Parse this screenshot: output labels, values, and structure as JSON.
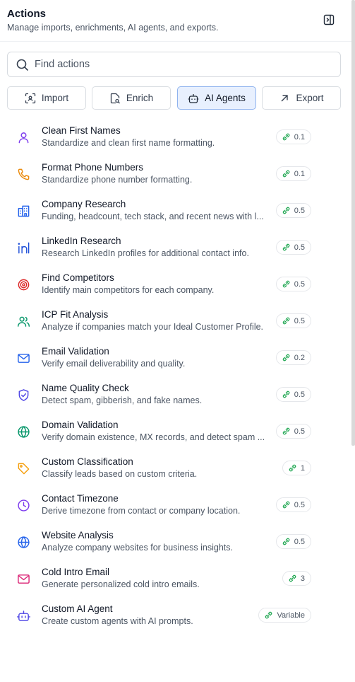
{
  "header": {
    "title": "Actions",
    "subtitle": "Manage imports, enrichments, AI agents, and exports."
  },
  "search": {
    "placeholder": "Find actions",
    "value": ""
  },
  "tabs": [
    {
      "label": "Import",
      "icon": "scan-icon",
      "active": false
    },
    {
      "label": "Enrich",
      "icon": "file-search-icon",
      "active": false
    },
    {
      "label": "AI Agents",
      "icon": "bot-icon",
      "active": true
    },
    {
      "label": "Export",
      "icon": "arrow-up-right-icon",
      "active": false
    }
  ],
  "colors": {
    "accent": "#1a73e8",
    "active_tab_bg": "#e8f0fe",
    "credit_green": "#16a34a"
  },
  "actions": [
    {
      "name": "Clean First Names",
      "desc": "Standardize and clean first name formatting.",
      "cost": "0.1",
      "icon": "user-icon",
      "color": "#7c3aed"
    },
    {
      "name": "Format Phone Numbers",
      "desc": "Standardize phone number formatting.",
      "cost": "0.1",
      "icon": "phone-icon",
      "color": "#ea8a0c"
    },
    {
      "name": "Company Research",
      "desc": "Funding, headcount, tech stack, and recent news with l...",
      "cost": "0.5",
      "icon": "building-icon",
      "color": "#2563eb"
    },
    {
      "name": "LinkedIn Research",
      "desc": "Research LinkedIn profiles for additional contact info.",
      "cost": "0.5",
      "icon": "linkedin-icon",
      "color": "#1d4ed8"
    },
    {
      "name": "Find Competitors",
      "desc": "Identify main competitors for each company.",
      "cost": "0.5",
      "icon": "target-icon",
      "color": "#dc2626"
    },
    {
      "name": "ICP Fit Analysis",
      "desc": "Analyze if companies match your Ideal Customer Profile.",
      "cost": "0.5",
      "icon": "users-icon",
      "color": "#059669"
    },
    {
      "name": "Email Validation",
      "desc": "Verify email deliverability and quality.",
      "cost": "0.2",
      "icon": "mail-icon",
      "color": "#2563eb"
    },
    {
      "name": "Name Quality Check",
      "desc": "Detect spam, gibberish, and fake names.",
      "cost": "0.5",
      "icon": "shield-check-icon",
      "color": "#4f46e5"
    },
    {
      "name": "Domain Validation",
      "desc": "Verify domain existence, MX records, and detect spam ...",
      "cost": "0.5",
      "icon": "globe-icon",
      "color": "#059669"
    },
    {
      "name": "Custom Classification",
      "desc": "Classify leads based on custom criteria.",
      "cost": "1",
      "icon": "tag-icon",
      "color": "#f59e0b"
    },
    {
      "name": "Contact Timezone",
      "desc": "Derive timezone from contact or company location.",
      "cost": "0.5",
      "icon": "clock-icon",
      "color": "#7c3aed"
    },
    {
      "name": "Website Analysis",
      "desc": "Analyze company websites for business insights.",
      "cost": "0.5",
      "icon": "globe-icon",
      "color": "#2563eb"
    },
    {
      "name": "Cold Intro Email",
      "desc": "Generate personalized cold intro emails.",
      "cost": "3",
      "icon": "mail-icon",
      "color": "#db2777"
    },
    {
      "name": "Custom AI Agent",
      "desc": "Create custom agents with AI prompts.",
      "cost": "Variable",
      "icon": "bot-icon",
      "color": "#4f46e5"
    }
  ]
}
